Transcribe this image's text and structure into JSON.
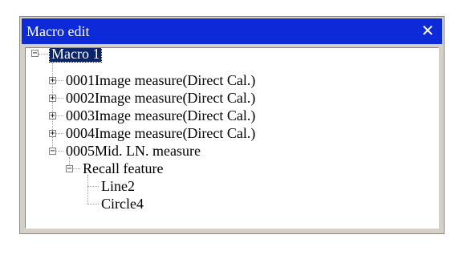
{
  "window": {
    "title": "Macro edit",
    "close_glyph": "✕",
    "title_color": "#0d2ad9"
  },
  "tree": {
    "root": {
      "label": "Macro 1",
      "expander": "−",
      "selected": true
    },
    "items": [
      {
        "label": "0001Image measure(Direct Cal.)",
        "expander": "+"
      },
      {
        "label": "0002Image measure(Direct Cal.)",
        "expander": "+"
      },
      {
        "label": "0003Image measure(Direct Cal.)",
        "expander": "+"
      },
      {
        "label": "0004Image measure(Direct Cal.)",
        "expander": "+"
      },
      {
        "label": "0005Mid. LN. measure",
        "expander": "−",
        "children": [
          {
            "label": "Recall feature",
            "expander": "−",
            "children": [
              {
                "label": "Line2"
              },
              {
                "label": "Circle4"
              }
            ]
          }
        ]
      }
    ]
  }
}
